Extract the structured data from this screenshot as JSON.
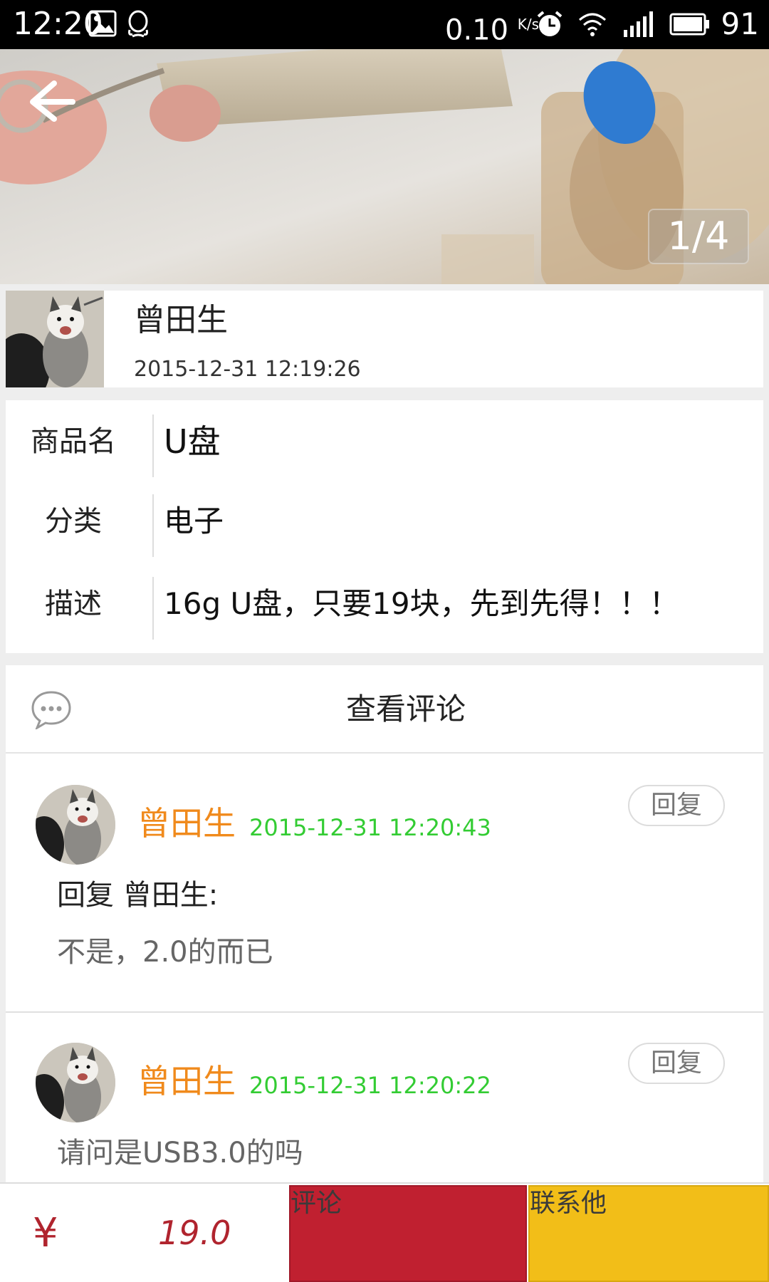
{
  "status_bar": {
    "time": "12:20",
    "net_speed": "0.10",
    "net_unit": "K/s",
    "battery": "91",
    "icons": [
      "image-icon",
      "qq-icon",
      "alarm-icon",
      "wifi-icon",
      "signal-icon",
      "battery-icon"
    ]
  },
  "gallery": {
    "pager": "1/4"
  },
  "seller": {
    "name": "曾田生",
    "time": "2015-12-31 12:19:26"
  },
  "details": [
    {
      "label": "商品名",
      "value": "U盘"
    },
    {
      "label": "分类",
      "value": "电子"
    },
    {
      "label": "描述",
      "value": "16g U盘，只要19块，先到先得！！！"
    }
  ],
  "comments_section": {
    "title": "查看评论",
    "items": [
      {
        "name": "曾田生",
        "time": "2015-12-31 12:20:43",
        "reply_label": "回复",
        "reply_to": "回复 曾田生:",
        "text": "不是，2.0的而已"
      },
      {
        "name": "曾田生",
        "time": "2015-12-31 12:20:22",
        "reply_label": "回复",
        "text": "请问是USB3.0的吗"
      }
    ]
  },
  "bottom_bar": {
    "currency": "¥",
    "price": "19.0",
    "comment_label": "评论",
    "contact_label": "联系他"
  },
  "colors": {
    "username": "#f08a1c",
    "timestamp": "#33cc33",
    "price": "#b0242e",
    "comment_button": "#c02030",
    "contact_button": "#f2be18"
  }
}
